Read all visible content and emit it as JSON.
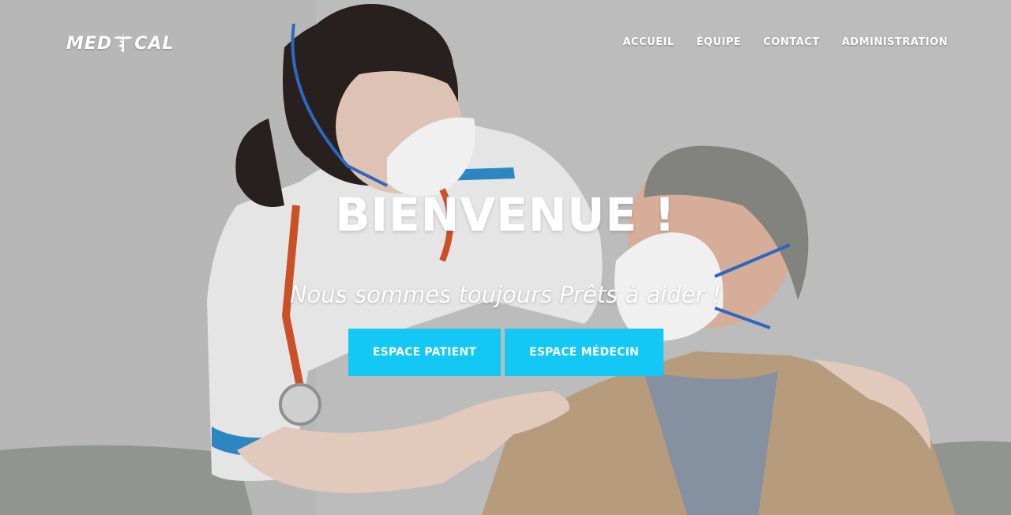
{
  "brand": {
    "logo_left": "MED",
    "logo_right": "CAL",
    "logo_icon": "caduceus-icon"
  },
  "nav": {
    "items": [
      {
        "label": "ACCUEIL"
      },
      {
        "label": "ÉQUIPE"
      },
      {
        "label": "CONTACT"
      },
      {
        "label": "ADMINISTRATION"
      }
    ]
  },
  "hero": {
    "title": "BIENVENUE !",
    "subtitle": "Nous sommes toujours Prêts à aider !",
    "patient_button": "ESPACE PATIENT",
    "medecin_button": "ESPACE MÉDECIN"
  },
  "colors": {
    "accent": "#13c8f5",
    "text": "#ffffff"
  }
}
